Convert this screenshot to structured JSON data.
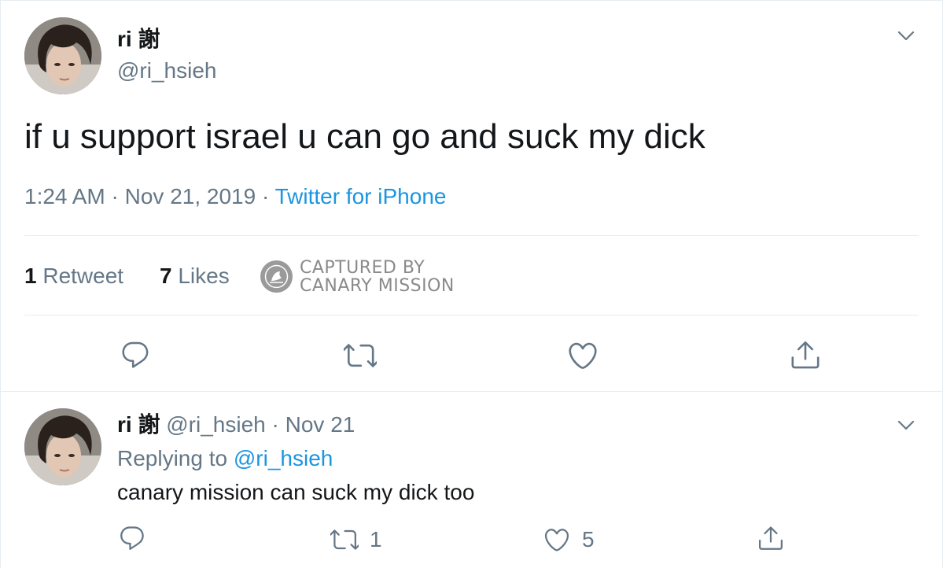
{
  "main_tweet": {
    "display_name": "ri 謝",
    "handle": "@ri_hsieh",
    "text": "if u support israel u can go and suck my dick",
    "time": "1:24 AM",
    "separator": "·",
    "date": "Nov 21, 2019",
    "source": "Twitter for iPhone",
    "stats": {
      "retweet_count": "1",
      "retweet_label": "Retweet",
      "like_count": "7",
      "like_label": "Likes"
    },
    "watermark": {
      "line1": "CAPTURED BY",
      "line2": "CANARY MISSION"
    },
    "actions": {
      "reply_icon": "reply-icon",
      "retweet_icon": "retweet-icon",
      "like_icon": "heart-icon",
      "share_icon": "share-icon"
    }
  },
  "reply_tweet": {
    "display_name": "ri 謝",
    "handle": "@ri_hsieh",
    "separator": "·",
    "date": "Nov 21",
    "replying_prefix": "Replying to",
    "replying_to": "@ri_hsieh",
    "text": "canary mission can suck my dick too",
    "retweet_count": "1",
    "like_count": "5"
  },
  "colors": {
    "text_primary": "#14171a",
    "text_secondary": "#657786",
    "link": "#1b95e0",
    "divider": "#e6ecf0",
    "watermark": "#8a8a8a"
  }
}
